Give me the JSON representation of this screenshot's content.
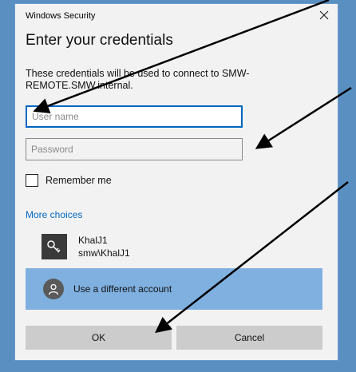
{
  "window": {
    "title": "Windows Security"
  },
  "dialog": {
    "heading": "Enter your credentials",
    "description": "These credentials will be used to connect to SMW-REMOTE.SMW.internal."
  },
  "fields": {
    "username_placeholder": "User name",
    "username_value": "",
    "password_placeholder": "Password",
    "password_value": ""
  },
  "remember": {
    "label": "Remember me",
    "checked": false
  },
  "more_choices": "More choices",
  "accounts": [
    {
      "name": "KhalJ1",
      "domain_user": "smw\\KhalJ1",
      "icon": "key-icon"
    }
  ],
  "different_account": {
    "label": "Use a different account",
    "icon": "person-icon",
    "color": "#7fb0e0"
  },
  "buttons": {
    "ok": "OK",
    "cancel": "Cancel"
  },
  "colors": {
    "accent": "#0067c0",
    "frame": "#5a8fc2",
    "annotation_arrow": "#000000"
  }
}
